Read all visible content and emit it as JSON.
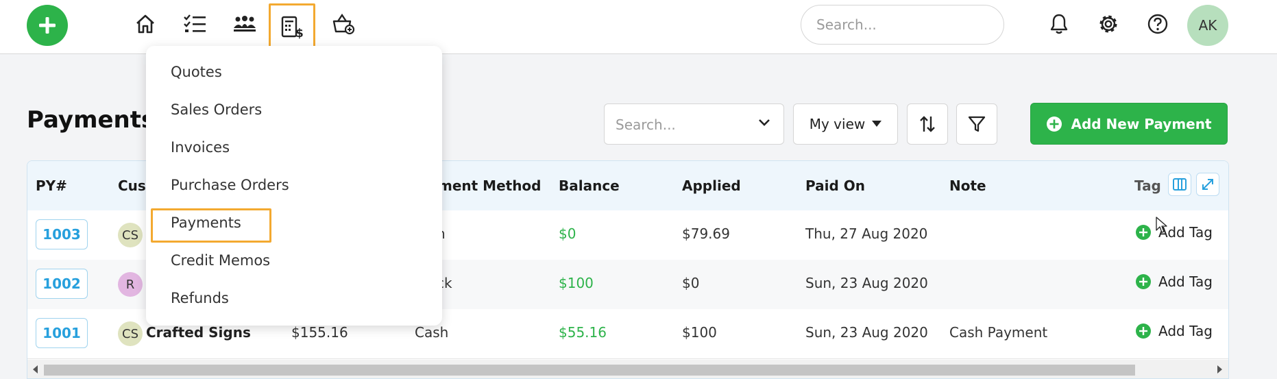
{
  "topbar": {
    "search_placeholder": "Search...",
    "avatar_initials": "AK",
    "nav_icons": [
      "home-icon",
      "tasks-icon",
      "customers-icon",
      "sales-icon",
      "products-icon"
    ]
  },
  "page": {
    "title": "Payments"
  },
  "toolbar": {
    "search_placeholder": "Search...",
    "view_label": "My view",
    "add_label": "Add New Payment"
  },
  "table": {
    "headers": {
      "py": "PY#",
      "customer": "Cust",
      "method": "ment Method",
      "balance": "Balance",
      "applied": "Applied",
      "paid_on": "Paid On",
      "note": "Note",
      "tags": "Tag"
    },
    "rows": [
      {
        "py": "1003",
        "initials": "CS",
        "customer": "",
        "amount": "",
        "method": "h",
        "balance": "$0",
        "applied": "$79.69",
        "paid_on": "Thu, 27 Aug 2020",
        "note": "",
        "tag": "Add Tag"
      },
      {
        "py": "1002",
        "initials": "R",
        "customer": "",
        "amount": "",
        "method": "ck",
        "balance": "$100",
        "applied": "$0",
        "paid_on": "Sun, 23 Aug 2020",
        "note": "",
        "tag": "Add Tag"
      },
      {
        "py": "1001",
        "initials": "CS",
        "customer": "Crafted Signs",
        "amount": "$155.16",
        "method": "Cash",
        "balance": "$55.16",
        "applied": "$100",
        "paid_on": "Sun, 23 Aug 2020",
        "note": "Cash Payment",
        "tag": "Add Tag"
      }
    ]
  },
  "dropdown": {
    "items": [
      "Quotes",
      "Sales Orders",
      "Invoices",
      "Purchase Orders",
      "Payments",
      "Credit Memos",
      "Refunds"
    ],
    "highlighted": "Payments"
  },
  "colors": {
    "brand_green": "#2db34a",
    "highlight": "#f3a930",
    "link_blue": "#27a0dd"
  }
}
